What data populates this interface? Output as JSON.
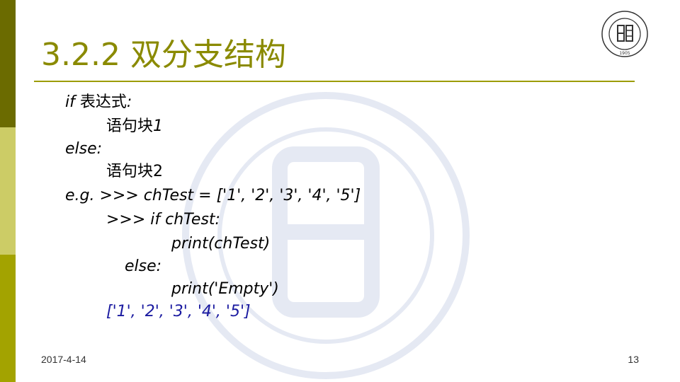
{
  "slide": {
    "title": "3.2.2 双分支结构",
    "lines": [
      {
        "prefix": "if ",
        "text": "表达式",
        "suffix": ":"
      },
      {
        "text": "语句块",
        "suffix": "1"
      },
      {
        "text": "else:"
      },
      {
        "text": "语句块2"
      },
      {
        "text": "e.g. >>> chTest = ['1', '2', '3', '4', '5']"
      },
      {
        "text": ">>> if chTest:"
      },
      {
        "text": "print(chTest)"
      },
      {
        "text": "else:"
      },
      {
        "text": "print('Empty')"
      },
      {
        "text": "['1', '2', '3', '4', '5']"
      }
    ]
  },
  "footer": {
    "date": "2017-4-14",
    "page_number": "13"
  },
  "logo": {
    "text": "FUDAN UNIVERSITY",
    "year": "1905"
  },
  "colors": {
    "accent": "#8a8a00",
    "rule": "#9c9c00",
    "bar_dark": "#6b6b00",
    "bar_light": "#cccc66",
    "bar_olive": "#a3a300",
    "output_text": "#1a1aa0"
  }
}
